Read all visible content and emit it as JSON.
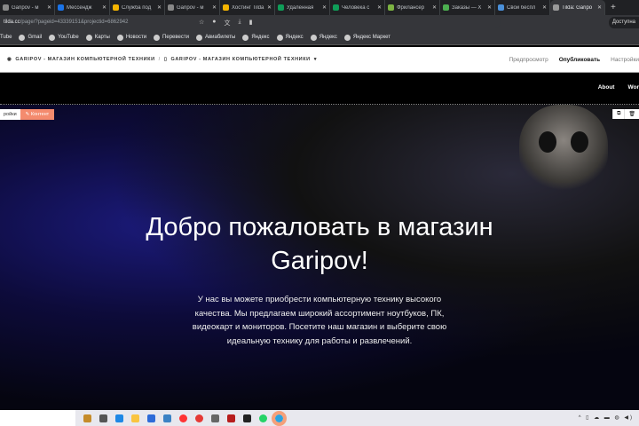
{
  "browser": {
    "tabs": [
      {
        "label": "Garipov - м",
        "color": "#888"
      },
      {
        "label": "Мессендж",
        "color": "#1a73e8"
      },
      {
        "label": "Служба под",
        "color": "#f4b400"
      },
      {
        "label": "Garipov - м",
        "color": "#888"
      },
      {
        "label": "Хостинг Tilda",
        "color": "#f4b400"
      },
      {
        "label": "Удаленная",
        "color": "#0f9d58"
      },
      {
        "label": "Человека с",
        "color": "#0f9d58"
      },
      {
        "label": "Фрилансер",
        "color": "#7cb342"
      },
      {
        "label": "Заказы — Х",
        "color": "#4caf50"
      },
      {
        "label": "Свой беспл",
        "color": "#4a90d9"
      },
      {
        "label": "Tilda: Garipo",
        "color": "#999"
      }
    ],
    "url_host": "tilda.cc",
    "url_path": "/page/?pageid=43339151&projectid=6862942",
    "profile_label": "Доступна",
    "bookmarks": [
      "Tube",
      "Gmail",
      "YouTube",
      "Карты",
      "Новости",
      "Перевести",
      "Авиабилеты",
      "Яндекс",
      "Яндекс",
      "Яндекс",
      "Яндекс Маркет"
    ]
  },
  "tilda": {
    "project": "GARIPOV - МАГАЗИН КОМПЬЮТЕРНОЙ ТЕХНИКИ",
    "page": "GARIPOV - МАГАЗИН КОМПЬЮТЕРНОЙ ТЕХНИКИ",
    "preview": "Предпросмотр",
    "publish": "Опубликовать",
    "settings": "Настройки",
    "block_settings": "ройки",
    "block_content": "Контент"
  },
  "site": {
    "nav": [
      "About",
      "Wor"
    ],
    "title": "Добро пожаловать в магазин Garipov!",
    "text": "У нас вы можете приобрести компьютерную технику высокого качества. Мы предлагаем широкий ассортимент ноутбуков, ПК, видеокарт и мониторов. Посетите наш магазин и выберите свою идеальную технику для работы и развлечений."
  }
}
